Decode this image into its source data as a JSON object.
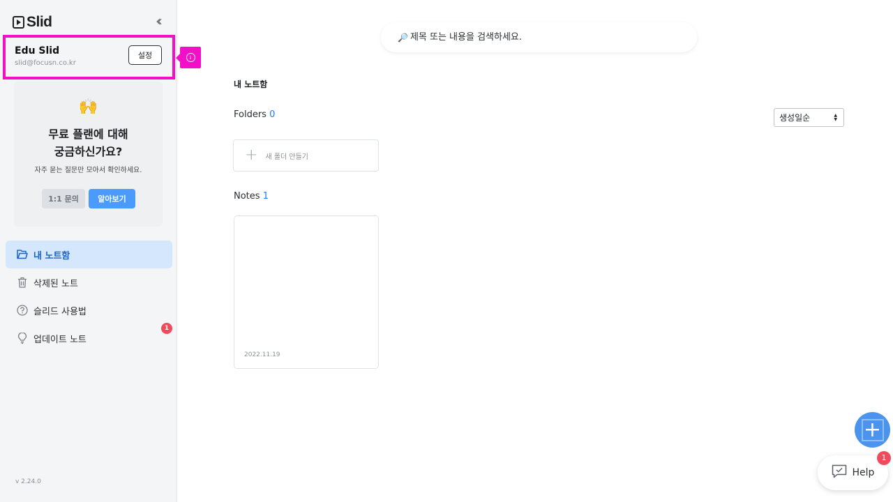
{
  "app": {
    "logo_text": "Slid",
    "version": "v 2.24.0"
  },
  "user": {
    "name": "Edu Slid",
    "email": "slid@focusn.co.kr",
    "settings_label": "설정"
  },
  "promo": {
    "emoji": "🙌",
    "title_line1": "무료 플랜에 대해",
    "title_line2": "궁금하신가요?",
    "description": "자주 묻는 질문만 모아서 확인하세요.",
    "inquiry_label": "1:1 문의",
    "learn_label": "알아보기"
  },
  "nav": {
    "items": [
      {
        "label": "내 노트함",
        "icon": "folder-open-icon",
        "active": true
      },
      {
        "label": "삭제된 노트",
        "icon": "trash-icon"
      },
      {
        "label": "슬리드 사용법",
        "icon": "question-circle-icon"
      },
      {
        "label": "업데이트 노트",
        "icon": "lightbulb-icon",
        "badge": "1"
      }
    ]
  },
  "search": {
    "placeholder": "제목 또는 내용을 검색하세요."
  },
  "main": {
    "section_title": "내 노트함",
    "folders_label": "Folders",
    "folders_count": "0",
    "sort_value": "생성일순",
    "new_folder_label": "새 폴더 만들기",
    "notes_label": "Notes",
    "notes_count": "1",
    "notes": [
      {
        "date": "2022.11.19"
      }
    ]
  },
  "help": {
    "label": "Help",
    "badge": "1"
  },
  "colors": {
    "accent": "#4b9bff",
    "highlight": "#f20fc7",
    "badge": "#ee4b5c"
  }
}
